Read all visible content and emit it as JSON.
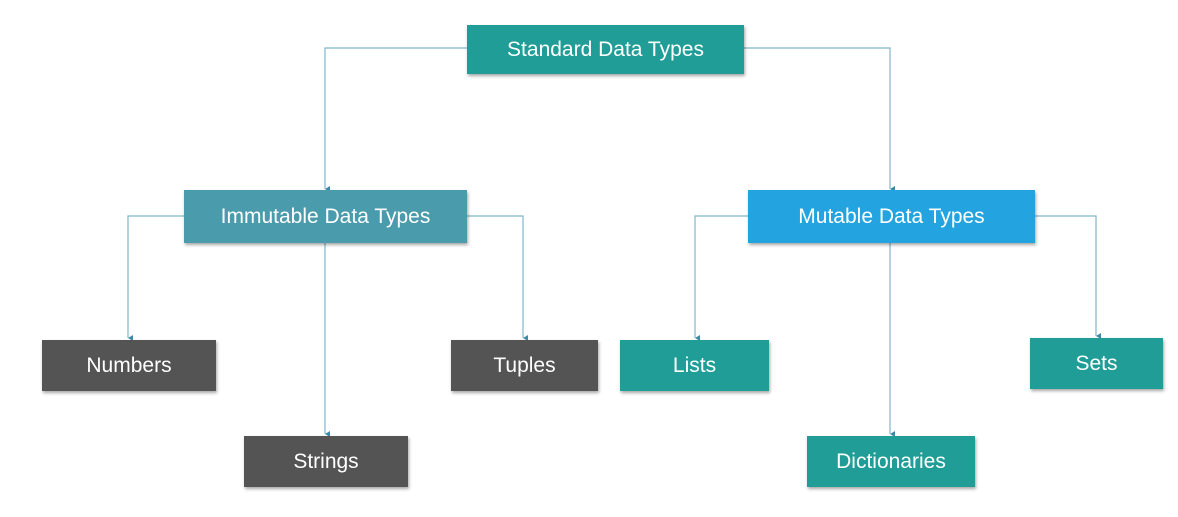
{
  "diagram": {
    "root": {
      "label": "Standard Data Types"
    },
    "immutable": {
      "label": "Immutable Data Types"
    },
    "mutable": {
      "label": "Mutable Data Types"
    },
    "numbers": {
      "label": "Numbers"
    },
    "strings": {
      "label": "Strings"
    },
    "tuples": {
      "label": "Tuples"
    },
    "lists": {
      "label": "Lists"
    },
    "dictionaries": {
      "label": "Dictionaries"
    },
    "sets": {
      "label": "Sets"
    }
  },
  "colors": {
    "root": "#1f9d96",
    "immutable": "#4a9cad",
    "mutable": "#23a4e0",
    "immutable_leaf": "#545454",
    "mutable_leaf": "#1f9d96",
    "connector": "#7fb8cc",
    "text": "#ffffff"
  }
}
